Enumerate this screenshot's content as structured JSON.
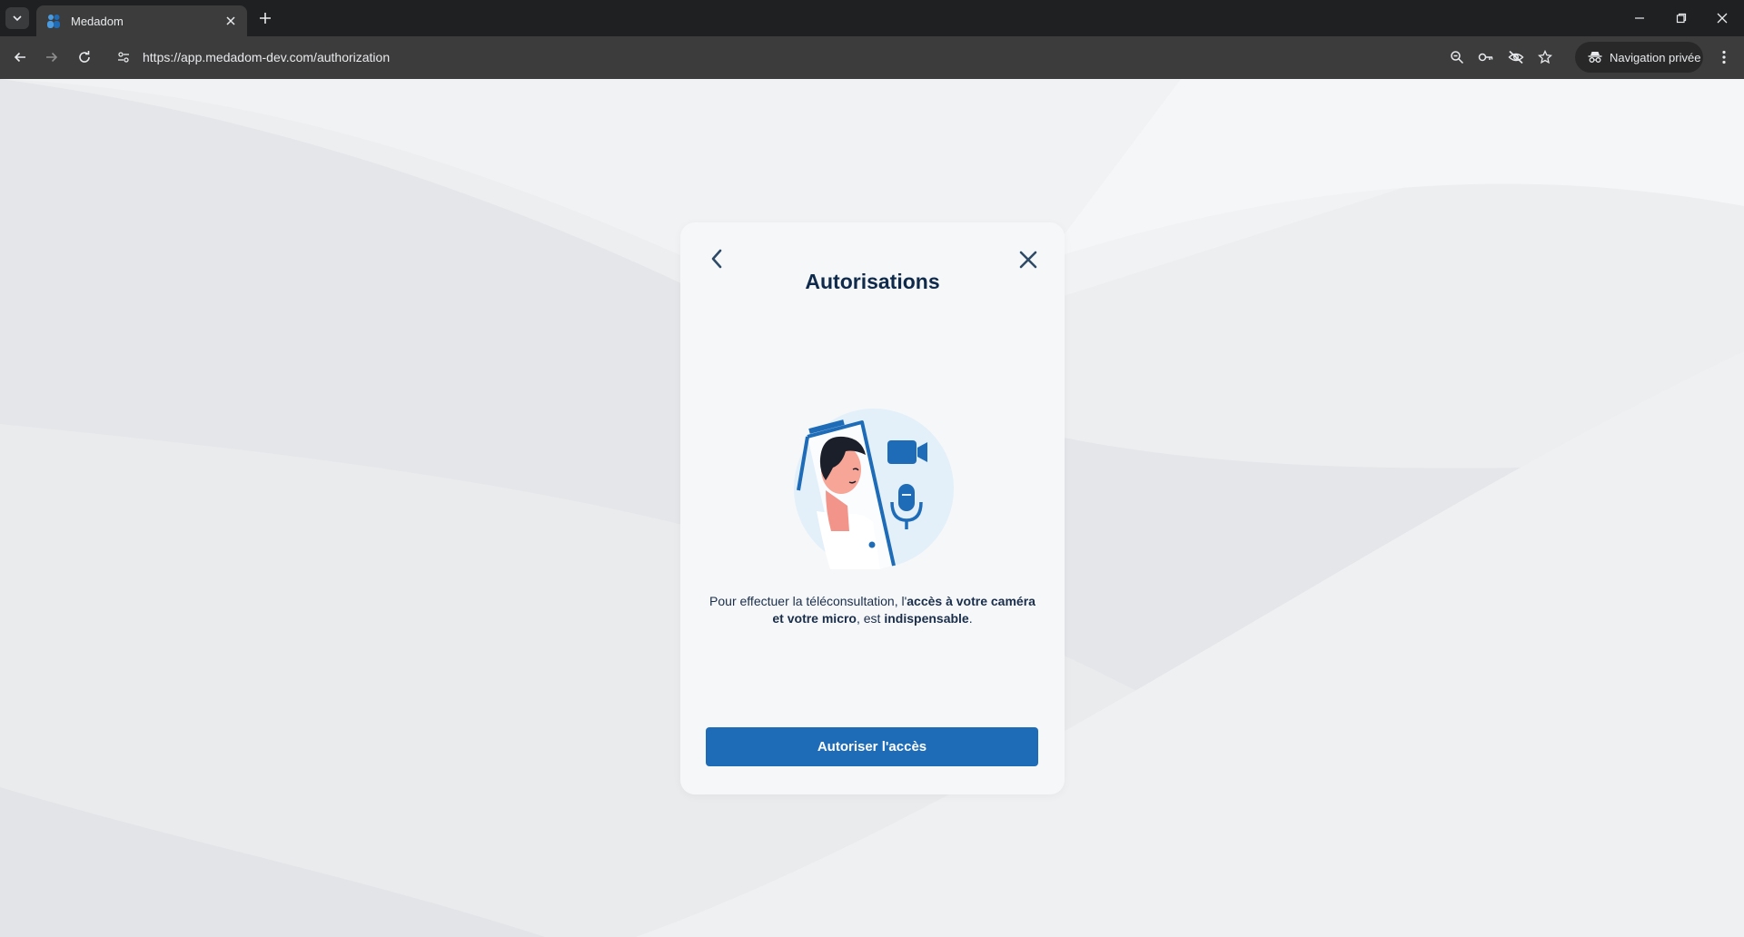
{
  "browser": {
    "tab": {
      "title": "Medadom",
      "favicon": "medadom-logo-icon"
    },
    "url": "https://app.medadom-dev.com/authorization",
    "incognito_label": "Navigation privée",
    "icons": [
      "tab-search-icon",
      "close-icon",
      "plus-icon",
      "minimize-icon",
      "restore-icon",
      "close-window-icon",
      "back-arrow-icon",
      "forward-arrow-icon",
      "reload-icon",
      "site-settings-icon",
      "zoom-icon",
      "password-key-icon",
      "eye-off-icon",
      "star-icon",
      "incognito-icon",
      "kebab-menu-icon"
    ]
  },
  "modal": {
    "title": "Autorisations",
    "description_parts": {
      "p1": "Pour effectuer la téléconsultation, l'",
      "b1": "accès à votre caméra et votre micro",
      "p2": ", est ",
      "b2": "indispensable",
      "p3": "."
    },
    "button_label": "Autoriser l'accès",
    "icons": [
      "back-arrow-icon",
      "close-icon",
      "camera-microphone-illustration"
    ]
  },
  "colors": {
    "primary": "#1e6cb7",
    "title": "#0f2a4a",
    "modal_bg": "#f5f7f9",
    "page_bg": "#eceef0",
    "browser_frame": "#3c3c3c"
  }
}
